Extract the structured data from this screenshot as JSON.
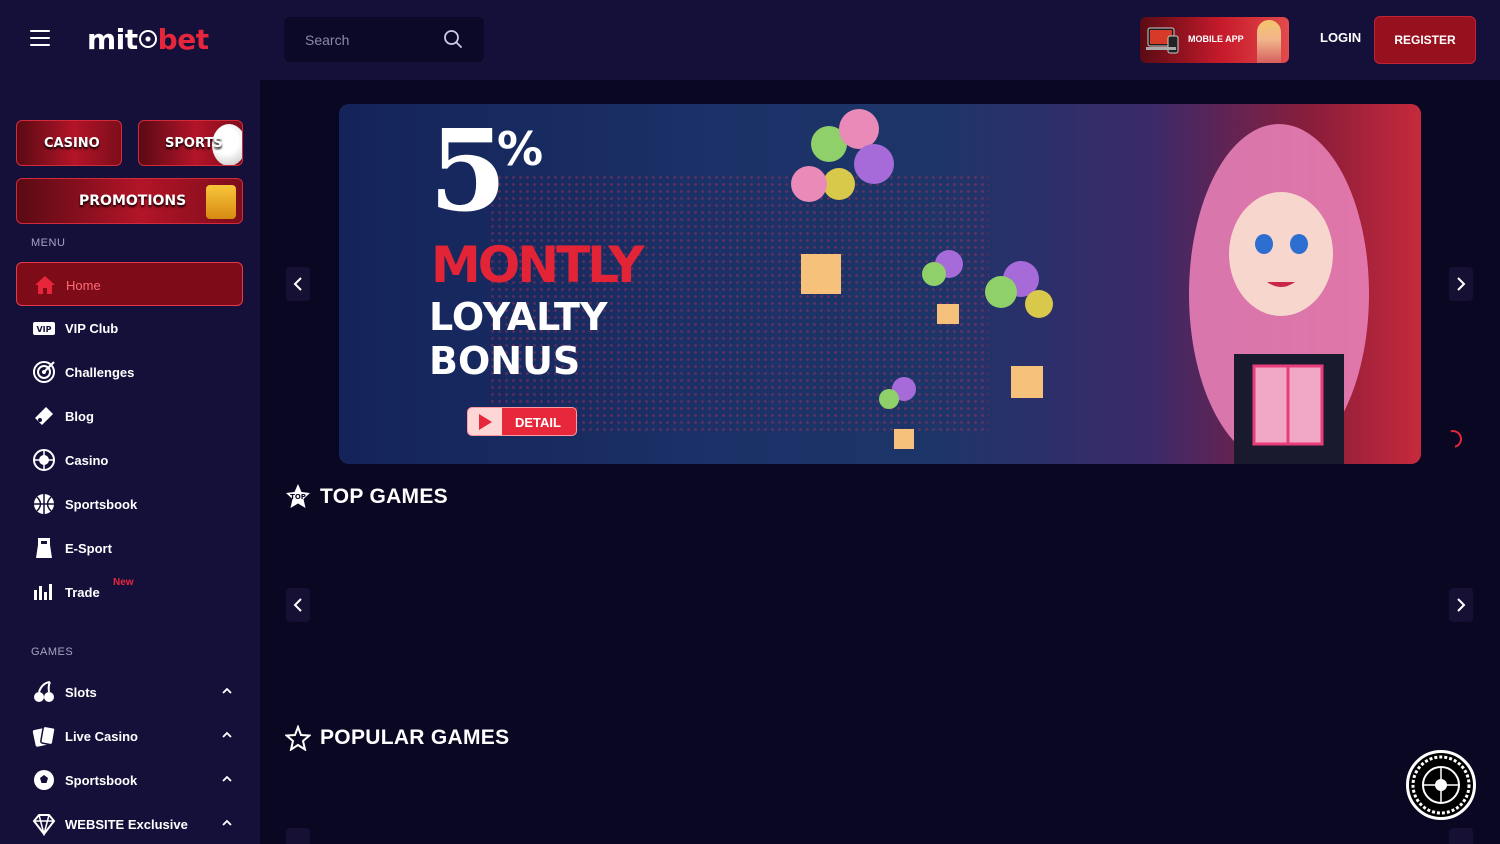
{
  "header": {
    "logo_part1": "mit",
    "logo_part2": "bet",
    "search_placeholder": "Search",
    "mobile_app_label": "MOBILE APP",
    "login_label": "LOGIN",
    "register_label": "REGISTER"
  },
  "sidebar": {
    "tiles": {
      "casino": "CASINO",
      "sports": "SPORTS",
      "promotions": "PROMOTIONS"
    },
    "menu_label": "MENU",
    "menu_items": [
      {
        "label": "Home",
        "icon": "home-icon"
      },
      {
        "label": "VIP Club",
        "icon": "vip-icon"
      },
      {
        "label": "Challenges",
        "icon": "target-icon"
      },
      {
        "label": "Blog",
        "icon": "blog-icon"
      },
      {
        "label": "Casino",
        "icon": "roulette-icon"
      },
      {
        "label": "Sportsbook",
        "icon": "basketball-icon"
      },
      {
        "label": "E-Sport",
        "icon": "esport-icon"
      },
      {
        "label": "Trade",
        "icon": "chart-icon",
        "badge": "New"
      }
    ],
    "games_label": "GAMES",
    "game_items": [
      {
        "label": "Slots",
        "icon": "cherry-icon"
      },
      {
        "label": "Live Casino",
        "icon": "cards-icon"
      },
      {
        "label": "Sportsbook",
        "icon": "football-icon"
      },
      {
        "label": "WEBSITE Exclusive",
        "icon": "diamond-icon"
      }
    ]
  },
  "banner": {
    "big_number": "5",
    "percent": "%",
    "line1": "MONTLY",
    "line2": "LOYALTY",
    "line3": "BONUS",
    "detail_label": "DETAIL"
  },
  "sections": {
    "top_games": "TOP GAMES",
    "popular_games": "POPULAR GAMES",
    "top_badge": "TOP"
  },
  "colors": {
    "accent": "#e8263b",
    "background": "#0a0722",
    "panel": "#15103a",
    "register_bg": "#97101e"
  }
}
